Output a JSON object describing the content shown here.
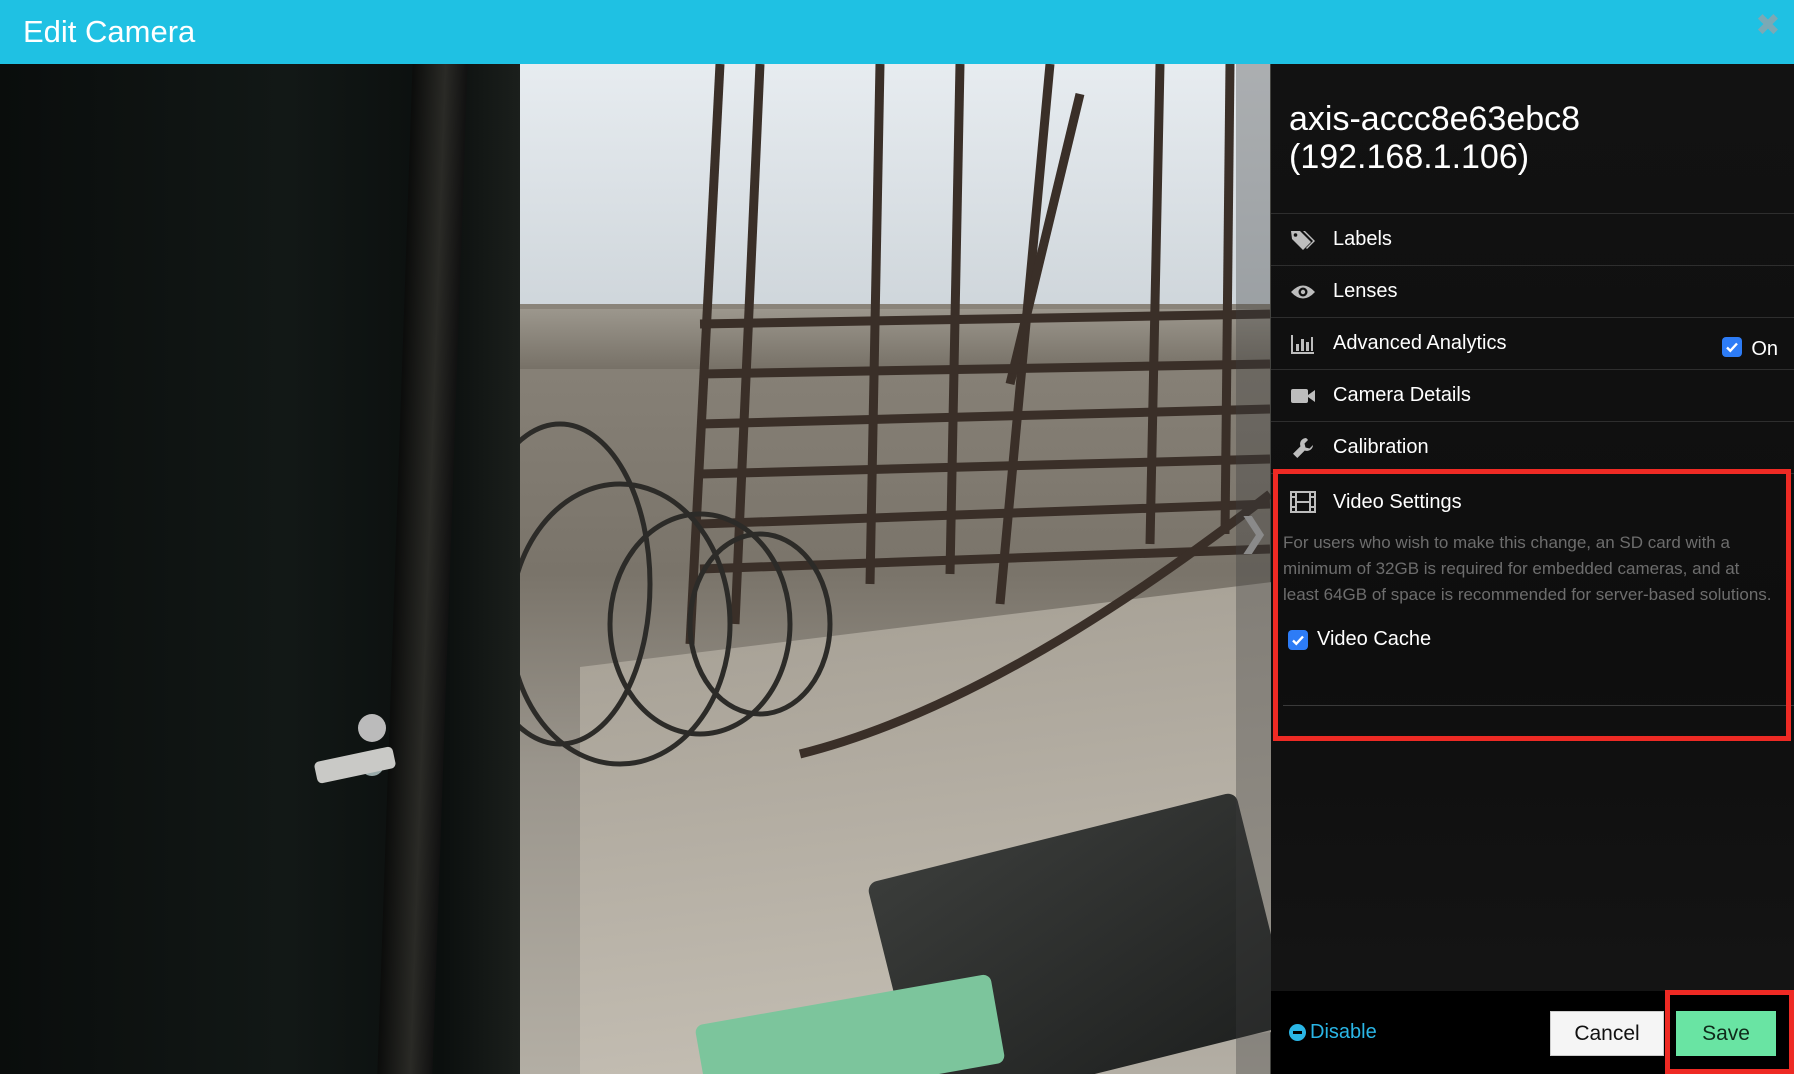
{
  "header": {
    "title": "Edit Camera",
    "close_icon": "close-icon"
  },
  "camera_view": {
    "collapse_glyph": "❯"
  },
  "panel": {
    "title": "axis-accc8e63ebc8 (192.168.1.106)",
    "menu": [
      {
        "label": "Labels",
        "icon": "tag-icon"
      },
      {
        "label": "Lenses",
        "icon": "eye-icon"
      },
      {
        "label": "Advanced Analytics",
        "icon": "bar-chart-icon",
        "toggle_label": "On",
        "checked": true
      },
      {
        "label": "Camera Details",
        "icon": "video-camera-icon"
      },
      {
        "label": "Calibration",
        "icon": "wrench-icon"
      }
    ],
    "video_settings": {
      "label": "Video Settings",
      "icon": "film-icon",
      "description": "For users who wish to make this change, an SD card with a minimum of 32GB is required for embedded cameras, and at least 64GB of space is recommended for server-based solutions.",
      "cache_label": "Video Cache",
      "cache_checked": true
    }
  },
  "footer": {
    "disable_label": "Disable",
    "cancel_label": "Cancel",
    "save_label": "Save"
  },
  "colors": {
    "header_bg": "#1fc1e3",
    "save_bg": "#69e4a3",
    "checkbox": "#2d7cf6",
    "highlight": "#ee2a24",
    "link": "#2ab6e6"
  }
}
